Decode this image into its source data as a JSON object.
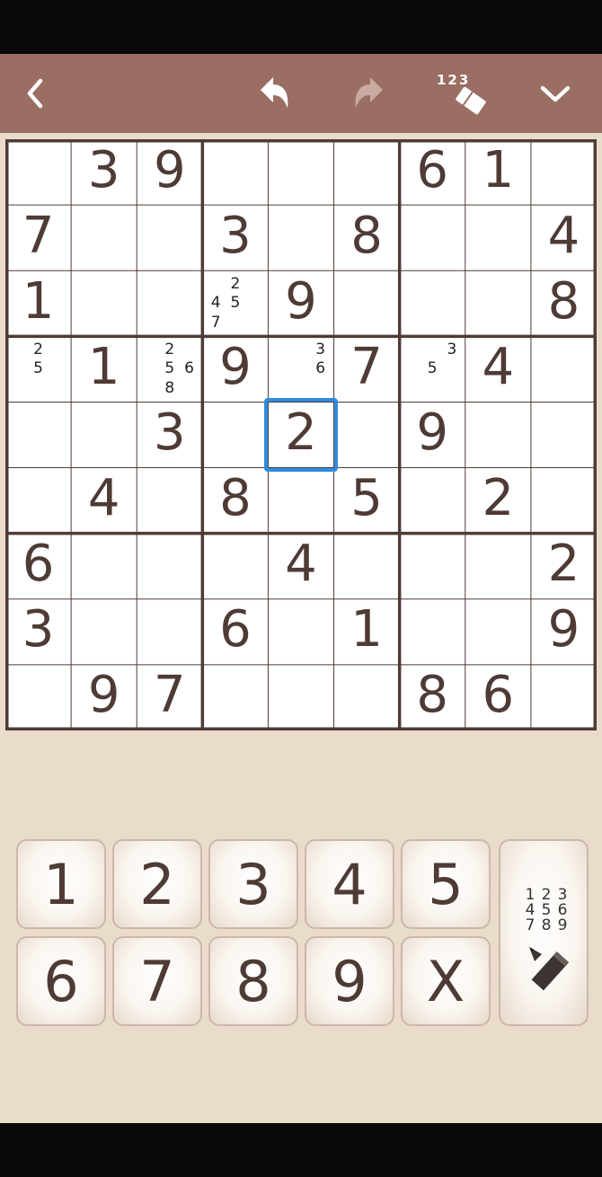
{
  "toolbar": {
    "back_icon": "chevron-left-icon",
    "undo_icon": "undo-icon",
    "redo_icon": "redo-icon",
    "erase_notes_label": "123",
    "erase_notes_icon": "eraser-icon",
    "menu_icon": "chevron-down-icon",
    "colors": {
      "bar": "#9a6e62",
      "icon": "#ffffff",
      "icon_disabled": "#c9aaa0"
    }
  },
  "board": {
    "size": 9,
    "colors": {
      "digit": "#4e3b35",
      "selection": "#2f8ae0",
      "grid": "#4e3b35"
    },
    "selected": {
      "row": 4,
      "col": 4
    },
    "cells": [
      [
        null,
        3,
        9,
        null,
        null,
        null,
        6,
        1,
        null
      ],
      [
        7,
        null,
        null,
        3,
        null,
        8,
        null,
        null,
        4
      ],
      [
        1,
        null,
        null,
        null,
        9,
        null,
        null,
        null,
        8
      ],
      [
        null,
        1,
        null,
        9,
        null,
        7,
        null,
        4,
        null
      ],
      [
        null,
        null,
        3,
        null,
        2,
        null,
        9,
        null,
        null
      ],
      [
        null,
        4,
        null,
        8,
        null,
        5,
        null,
        2,
        null
      ],
      [
        6,
        null,
        null,
        null,
        4,
        null,
        null,
        null,
        2
      ],
      [
        3,
        null,
        null,
        6,
        null,
        1,
        null,
        null,
        9
      ],
      [
        null,
        9,
        7,
        null,
        null,
        null,
        8,
        6,
        null
      ]
    ],
    "notes": [
      {
        "row": 2,
        "col": 3,
        "candidates": [
          2,
          4,
          5,
          7
        ]
      },
      {
        "row": 3,
        "col": 0,
        "candidates": [
          2,
          5
        ]
      },
      {
        "row": 3,
        "col": 2,
        "candidates": [
          2,
          5,
          6,
          8
        ]
      },
      {
        "row": 3,
        "col": 4,
        "candidates": [
          3,
          6
        ]
      },
      {
        "row": 3,
        "col": 6,
        "candidates": [
          3,
          5
        ]
      }
    ]
  },
  "keypad": {
    "keys": [
      "1",
      "2",
      "3",
      "4",
      "5",
      "6",
      "7",
      "8",
      "9",
      "X"
    ],
    "notes_key": {
      "digits": [
        "1",
        "2",
        "3",
        "4",
        "5",
        "6",
        "7",
        "8",
        "9"
      ],
      "icon": "pencil-icon"
    }
  }
}
